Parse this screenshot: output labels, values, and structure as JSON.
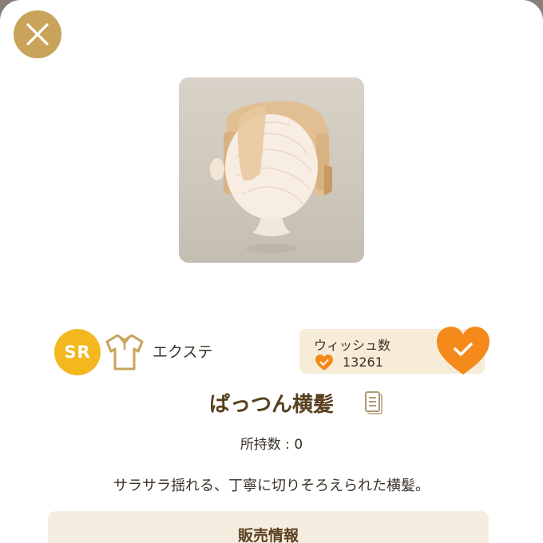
{
  "item": {
    "rarity": "SR",
    "category_icon": "shirt-icon",
    "category": "エクステ",
    "name": "ぱっつん横髪",
    "owned_label": "所持数",
    "owned_count": "0",
    "owned_text": "所持数 : 0",
    "description": "サラサラ揺れる、丁寧に切りそろえられた横髪。"
  },
  "wish": {
    "title": "ウィッシュ数",
    "count": "13261",
    "wished": true
  },
  "sale": {
    "title": "販売情報"
  },
  "colors": {
    "accent_gold": "#c9a35a",
    "rarity_sr": "#f2b81e",
    "wish_orange": "#f5891a",
    "title_brown": "#5a3f1e"
  },
  "icons": {
    "close": "close-icon",
    "detail": "document-icon",
    "wish": "heart-check-icon"
  }
}
